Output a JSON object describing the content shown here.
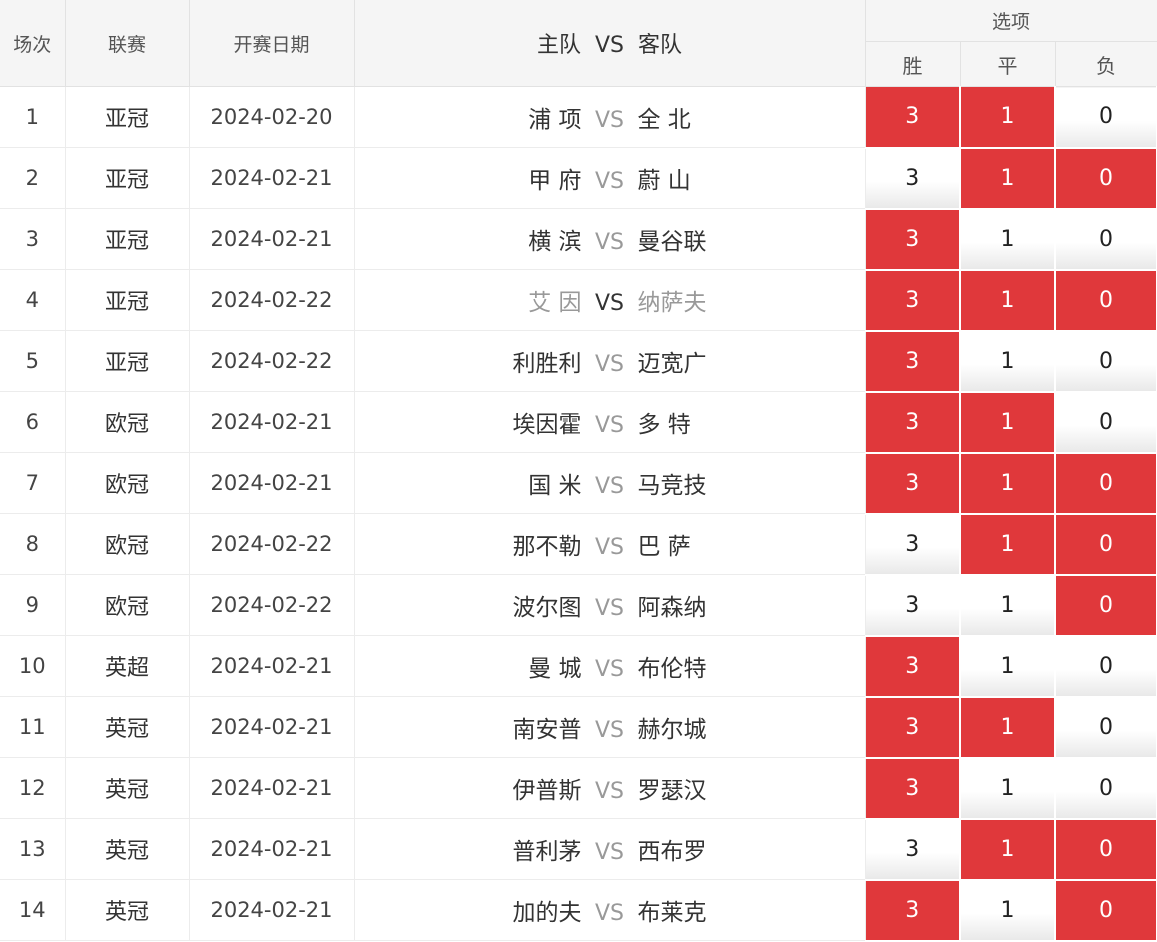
{
  "header": {
    "index": "场次",
    "league": "联赛",
    "date": "开赛日期",
    "home": "主队",
    "vs": "VS",
    "away": "客队",
    "options": "选项",
    "win": "胜",
    "draw": "平",
    "lose": "负"
  },
  "colors": {
    "selected": "#e0383b",
    "unselected": "#f2f2f2",
    "vs_grey": "#999999"
  },
  "rows": [
    {
      "idx": "1",
      "league": "亚冠",
      "date": "2024-02-20",
      "home": "浦 项",
      "away": "全 北",
      "grey": false,
      "win": "3",
      "draw": "1",
      "lose": "0",
      "sel": [
        1,
        1,
        0
      ]
    },
    {
      "idx": "2",
      "league": "亚冠",
      "date": "2024-02-21",
      "home": "甲 府",
      "away": "蔚 山",
      "grey": false,
      "win": "3",
      "draw": "1",
      "lose": "0",
      "sel": [
        0,
        1,
        1
      ]
    },
    {
      "idx": "3",
      "league": "亚冠",
      "date": "2024-02-21",
      "home": "横 滨",
      "away": "曼谷联",
      "grey": false,
      "win": "3",
      "draw": "1",
      "lose": "0",
      "sel": [
        1,
        0,
        0
      ]
    },
    {
      "idx": "4",
      "league": "亚冠",
      "date": "2024-02-22",
      "home": "艾 因",
      "away": "纳萨夫",
      "grey": true,
      "win": "3",
      "draw": "1",
      "lose": "0",
      "sel": [
        1,
        1,
        1
      ]
    },
    {
      "idx": "5",
      "league": "亚冠",
      "date": "2024-02-22",
      "home": "利胜利",
      "away": "迈宽广",
      "grey": false,
      "win": "3",
      "draw": "1",
      "lose": "0",
      "sel": [
        1,
        0,
        0
      ]
    },
    {
      "idx": "6",
      "league": "欧冠",
      "date": "2024-02-21",
      "home": "埃因霍",
      "away": "多 特",
      "grey": false,
      "win": "3",
      "draw": "1",
      "lose": "0",
      "sel": [
        1,
        1,
        0
      ]
    },
    {
      "idx": "7",
      "league": "欧冠",
      "date": "2024-02-21",
      "home": "国 米",
      "away": "马竞技",
      "grey": false,
      "win": "3",
      "draw": "1",
      "lose": "0",
      "sel": [
        1,
        1,
        1
      ]
    },
    {
      "idx": "8",
      "league": "欧冠",
      "date": "2024-02-22",
      "home": "那不勒",
      "away": "巴 萨",
      "grey": false,
      "win": "3",
      "draw": "1",
      "lose": "0",
      "sel": [
        0,
        1,
        1
      ]
    },
    {
      "idx": "9",
      "league": "欧冠",
      "date": "2024-02-22",
      "home": "波尔图",
      "away": "阿森纳",
      "grey": false,
      "win": "3",
      "draw": "1",
      "lose": "0",
      "sel": [
        0,
        0,
        1
      ]
    },
    {
      "idx": "10",
      "league": "英超",
      "date": "2024-02-21",
      "home": "曼 城",
      "away": "布伦特",
      "grey": false,
      "win": "3",
      "draw": "1",
      "lose": "0",
      "sel": [
        1,
        0,
        0
      ]
    },
    {
      "idx": "11",
      "league": "英冠",
      "date": "2024-02-21",
      "home": "南安普",
      "away": "赫尔城",
      "grey": false,
      "win": "3",
      "draw": "1",
      "lose": "0",
      "sel": [
        1,
        1,
        0
      ]
    },
    {
      "idx": "12",
      "league": "英冠",
      "date": "2024-02-21",
      "home": "伊普斯",
      "away": "罗瑟汉",
      "grey": false,
      "win": "3",
      "draw": "1",
      "lose": "0",
      "sel": [
        1,
        0,
        0
      ]
    },
    {
      "idx": "13",
      "league": "英冠",
      "date": "2024-02-21",
      "home": "普利茅",
      "away": "西布罗",
      "grey": false,
      "win": "3",
      "draw": "1",
      "lose": "0",
      "sel": [
        0,
        1,
        1
      ]
    },
    {
      "idx": "14",
      "league": "英冠",
      "date": "2024-02-21",
      "home": "加的夫",
      "away": "布莱克",
      "grey": false,
      "win": "3",
      "draw": "1",
      "lose": "0",
      "sel": [
        1,
        0,
        1
      ]
    }
  ]
}
